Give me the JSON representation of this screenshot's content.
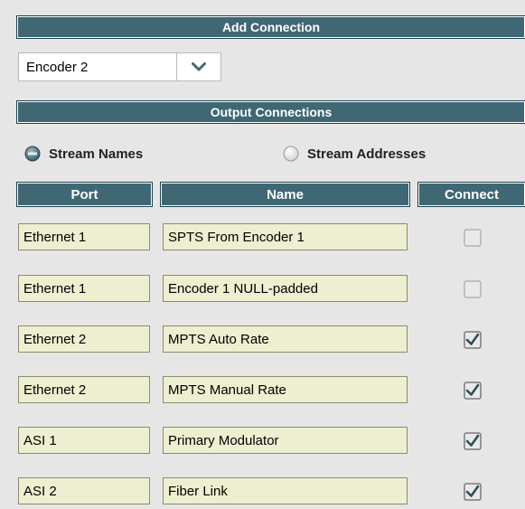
{
  "add_connection": {
    "title": "Add Connection",
    "encoder_select": {
      "value": "Encoder 2"
    }
  },
  "output_connections": {
    "title": "Output Connections",
    "radios": [
      {
        "label": "Stream Names",
        "checked": true
      },
      {
        "label": "Stream Addresses",
        "checked": false
      }
    ]
  },
  "table": {
    "headers": {
      "port": "Port",
      "name": "Name",
      "connect": "Connect"
    },
    "rows": [
      {
        "port": "Ethernet 1",
        "name": "SPTS From Encoder 1",
        "connect": false
      },
      {
        "port": "Ethernet 1",
        "name": "Encoder 1 NULL-padded",
        "connect": false
      },
      {
        "port": "Ethernet 2",
        "name": "MPTS Auto Rate",
        "connect": true
      },
      {
        "port": "Ethernet 2",
        "name": "MPTS Manual Rate",
        "connect": true
      },
      {
        "port": "ASI 1",
        "name": "Primary Modulator",
        "connect": true
      },
      {
        "port": "ASI 2",
        "name": "Fiber Link",
        "connect": true
      }
    ]
  },
  "colors": {
    "header_bar": "#3f6874",
    "field_bg": "#eeeed0",
    "panel_bg": "#e6e6e6"
  }
}
